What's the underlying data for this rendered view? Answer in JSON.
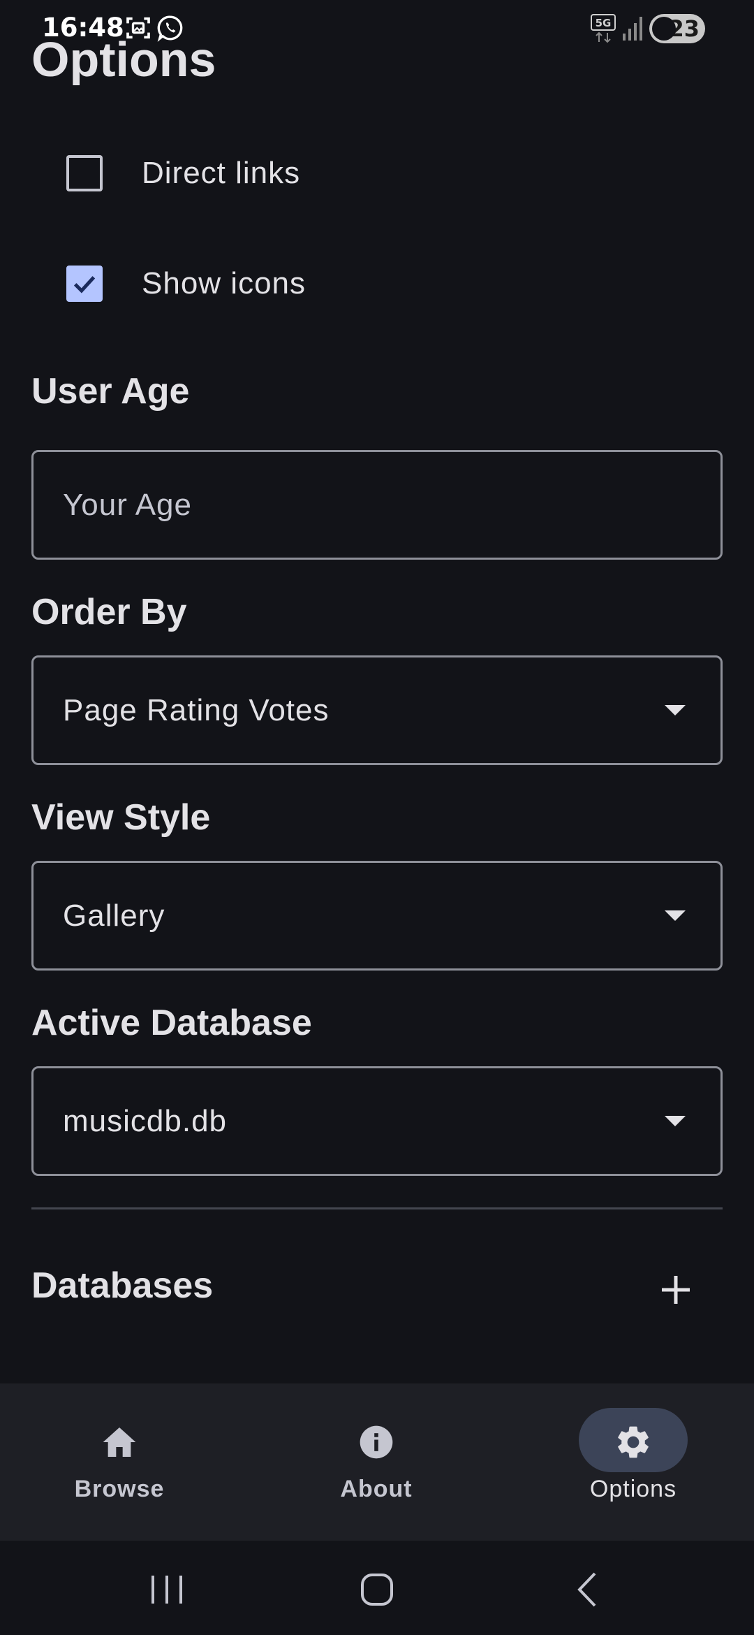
{
  "status_bar": {
    "time": "16:48",
    "network": "5G",
    "battery": "23",
    "icons": [
      "screenshot-icon",
      "whatsapp-icon",
      "5g-icon",
      "signal-icon",
      "battery-icon"
    ]
  },
  "page": {
    "title": "Options"
  },
  "options": {
    "direct_links": {
      "label": "Direct links",
      "checked": false
    },
    "show_icons": {
      "label": "Show icons",
      "checked": true
    }
  },
  "user_age": {
    "label": "User Age",
    "value": "",
    "placeholder": "Your Age"
  },
  "order_by": {
    "label": "Order By",
    "value": "Page Rating Votes"
  },
  "view_style": {
    "label": "View Style",
    "value": "Gallery"
  },
  "active_database": {
    "label": "Active Database",
    "value": "musicdb.db"
  },
  "databases": {
    "label": "Databases",
    "add_icon": "plus-icon"
  },
  "bottom_nav": {
    "items": [
      {
        "label": "Browse",
        "icon": "home-icon",
        "active": false
      },
      {
        "label": "About",
        "icon": "info-icon",
        "active": false
      },
      {
        "label": "Options",
        "icon": "gear-icon",
        "active": true
      }
    ]
  },
  "colors": {
    "background": "#121318",
    "nav_background": "#1e1f25",
    "accent": "#b4c5ff",
    "active_pill": "#3c4458",
    "outline": "#8e9099"
  }
}
